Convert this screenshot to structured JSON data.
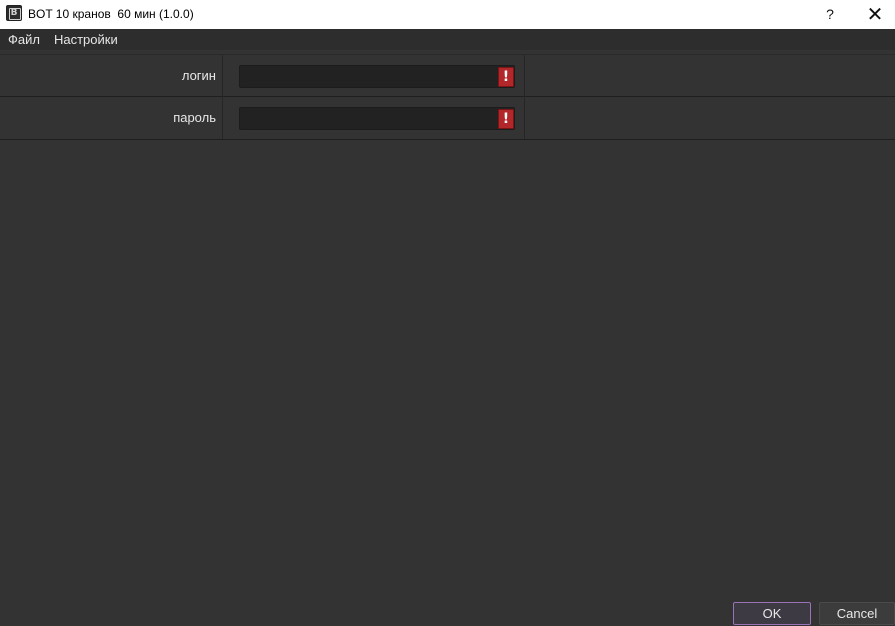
{
  "window": {
    "icon_letter": "B",
    "title": "BOT 10 кранов  60 мин (1.0.0)",
    "help_label": "?",
    "close_label": "✕"
  },
  "menu": {
    "items": [
      {
        "label": "Файл"
      },
      {
        "label": "Настройки"
      }
    ]
  },
  "form": {
    "login": {
      "label": "логин",
      "value": "",
      "warning": "!"
    },
    "password": {
      "label": "пароль",
      "value": "",
      "warning": "!"
    }
  },
  "buttons": {
    "ok_label": "OK",
    "cancel_label": "Cancel"
  },
  "colors": {
    "background": "#333333",
    "accent_ok_border": "#9a72b8",
    "warning": "#b1272a"
  }
}
